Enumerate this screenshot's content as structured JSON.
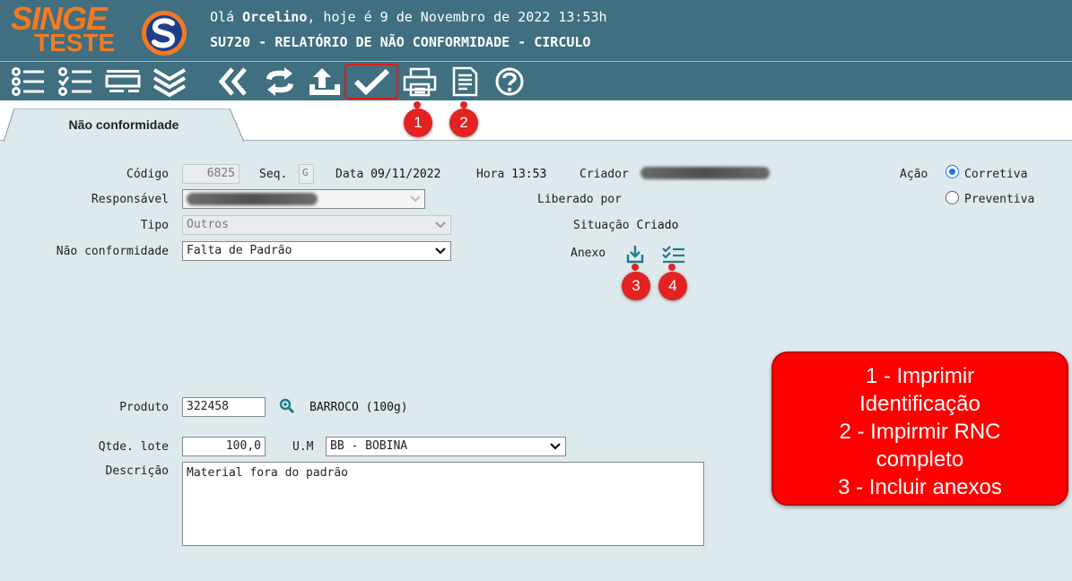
{
  "header": {
    "logo_top": "SINGE",
    "logo_bottom": "TESTE",
    "greeting_prefix": "Olá",
    "user_name": "Orcelino",
    "greeting_suffix": ", hoje é 9 de Novembro de 2022 13:53h",
    "report_title": "SU720 - RELATÓRIO DE NÃO CONFORMIDADE - CIRCULO"
  },
  "toolbar": {
    "buttons": [
      "list-icon",
      "checklist-icon",
      "form-icon",
      "chevrons-down-icon",
      "double-chevron-left-icon",
      "refresh-icon",
      "upload-icon",
      "check-icon",
      "printer-icon",
      "document-icon",
      "help-icon"
    ],
    "highlighted": "check-icon"
  },
  "tabs": [
    {
      "label": "Não conformidade",
      "active": true
    }
  ],
  "form": {
    "codigo_label": "Código",
    "codigo_value": "6825",
    "seq_label": "Seq.",
    "seq_value": "G",
    "data_label": "Data",
    "data_value": "09/11/2022",
    "hora_label": "Hora",
    "hora_value": "13:53",
    "criador_label": "Criador",
    "responsavel_label": "Responsável",
    "tipo_label": "Tipo",
    "tipo_value": "Outros",
    "nao_conformidade_label": "Não conformidade",
    "nao_conformidade_value": "Falta de Padrão",
    "liberado_label": "Liberado por",
    "situacao_label": "Situação",
    "situacao_value": "Criado",
    "anexo_label": "Anexo",
    "acao_label": "Ação",
    "acao_options": [
      {
        "label": "Corretiva",
        "checked": true
      },
      {
        "label": "Preventiva",
        "checked": false
      }
    ],
    "produto_label": "Produto",
    "produto_value": "322458",
    "produto_desc": "BARROCO (100g)",
    "qtde_label": "Qtde. lote",
    "qtde_value": "100,0",
    "um_label": "U.M",
    "um_value": "BB - BOBINA",
    "descricao_label": "Descrição",
    "descricao_value": "Material fora do padrão"
  },
  "badges": [
    "1",
    "2",
    "3",
    "4"
  ],
  "callout": {
    "lines": [
      "1 - Imprimir",
      "Identificação",
      "2 - Impirmir RNC",
      "completo",
      "3 - Incluir anexos"
    ]
  },
  "colors": {
    "header_bg": "#3f6f80",
    "content_bg": "#dde9ec",
    "logo_orange": "#f47a20",
    "badge_red": "#e32222",
    "callout_red": "#ff0000"
  }
}
